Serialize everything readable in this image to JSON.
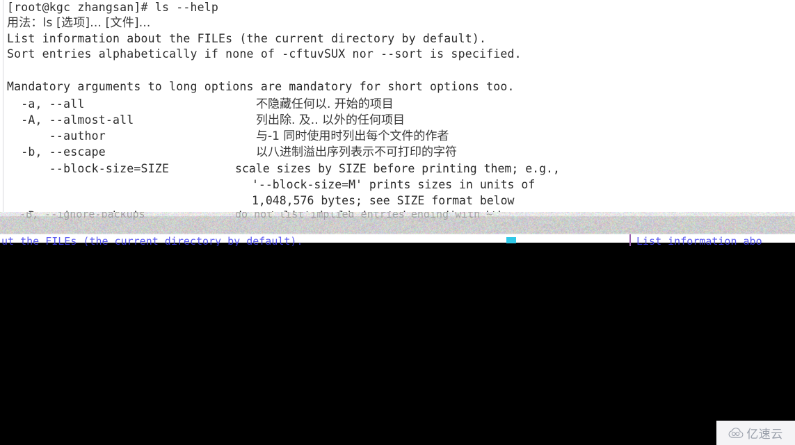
{
  "terminal": {
    "prompt_line": "[root@kgc zhangsan]# ls --help",
    "usage_line": "用法：ls [选项]... [文件]...",
    "description_lines": [
      "List information about the FILEs (the current directory by default).",
      "Sort entries alphabetically if none of -cftuvSUX nor --sort is specified."
    ],
    "mandatory_note": "Mandatory arguments to long options are mandatory for short options too.",
    "options": [
      {
        "flags": "  -a, --all",
        "desc": "不隐藏任何以. 开始的项目",
        "desc_lang": "cn"
      },
      {
        "flags": "  -A, --almost-all",
        "desc": "列出除. 及.. 以外的任何项目",
        "desc_lang": "cn"
      },
      {
        "flags": "      --author",
        "desc": "与-1 同时使用时列出每个文件的作者",
        "desc_lang": "cn"
      },
      {
        "flags": "  -b, --escape",
        "desc": "以八进制溢出序列表示不可打印的字符",
        "desc_lang": "cn"
      },
      {
        "flags": "      --block-size=SIZE",
        "desc": "scale sizes by SIZE before printing them; e.g.,",
        "desc_lang": "en"
      }
    ],
    "block_size_continuation": [
      "'--block-size=M' prints sizes in units of",
      "1,048,576 bytes; see SIZE format below"
    ],
    "clipped_option": {
      "flags": "  -B, --ignore-backups",
      "desc": "do not list implied entries ending with ~"
    }
  },
  "glitch": {
    "ghost_text_left": "ut the FILEs (the current directory by default).",
    "ghost_text_right": "List information abo"
  },
  "watermark": {
    "text": "亿速云",
    "logo_name": "cloud-logo"
  },
  "colors": {
    "terminal_background": "#ffffff",
    "terminal_text": "#2b2b2b",
    "page_background": "#000000",
    "glitch_blue": "#3d3df0",
    "glitch_cyan": "#30c9e8",
    "watermark_text": "#9aa0ab"
  }
}
